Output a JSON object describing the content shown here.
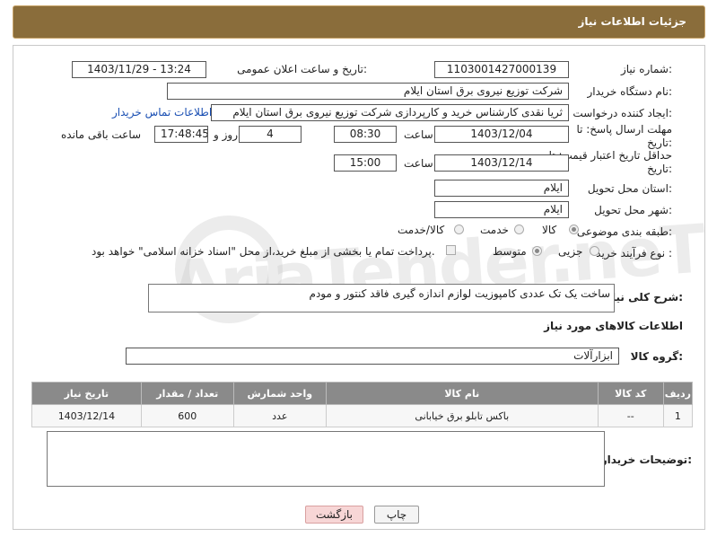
{
  "header": {
    "title": "جزئیات اطلاعات نیاز"
  },
  "form": {
    "need_number_label": "شماره نیاز:",
    "need_number": "1103001427000139",
    "announce_label": "تاریخ و ساعت اعلان عمومی:",
    "announce_value": "1403/11/29 - 13:24",
    "buyer_org_label": "نام دستگاه خریدار:",
    "buyer_org": "شرکت توزیع نیروی برق استان ایلام",
    "requester_label": "ایجاد کننده درخواست:",
    "requester": "ثریا نقدی کارشناس خرید و کارپردازی شرکت توزیع نیروی برق استان ایلام",
    "contact_link": "اطلاعات تماس خریدار",
    "deadline_label": "مهلت ارسال پاسخ: تا تاریخ:",
    "deadline_date": "1403/12/04",
    "time_label": "ساعت",
    "deadline_time": "08:30",
    "days_value": "4",
    "days_label": "روز و",
    "remaining_time": "17:48:45",
    "remaining_label": "ساعت باقی مانده",
    "validity_label": "حداقل تاریخ اعتبار قیمت: تا تاریخ:",
    "validity_date": "1403/12/14",
    "validity_time": "15:00",
    "province_label": "استان محل تحویل:",
    "province": "ایلام",
    "city_label": "شهر محل تحویل:",
    "city": "ایلام",
    "category_label": "طبقه بندی موضوعی:",
    "category_options": [
      "کالا",
      "خدمت",
      "کالا/خدمت"
    ],
    "category_selected": "کالا",
    "process_label": "نوع فرآیند خرید :",
    "process_options": [
      "جزیی",
      "متوسط"
    ],
    "payment_note": "پرداخت تمام یا بخشی از مبلغ خرید،از محل \"اسناد خزانه اسلامی\" خواهد بود.",
    "description_label": "شرح کلی نیاز:",
    "description": "ساخت یک تک عددی کامپوزیت لوازم اندازه گیری فاقد کنتور و مودم",
    "goods_info_title": "اطلاعات کالاهای مورد نیاز",
    "goods_group_label": "گروه کالا:",
    "goods_group": "ابزارآلات",
    "buyer_notes_label": "توضیحات خریدار:"
  },
  "table": {
    "headers": [
      "ردیف",
      "کد کالا",
      "نام کالا",
      "واحد شمارش",
      "تعداد / مقدار",
      "تاریخ نیاز"
    ],
    "rows": [
      [
        "1",
        "--",
        "باکس تابلو برق خیابانی",
        "عدد",
        "600",
        "1403/12/14"
      ]
    ]
  },
  "buttons": {
    "print": "چاپ",
    "back": "بازگشت"
  },
  "watermark": "AriaTender.neT",
  "colors": {
    "header_bg": "#8a6d3b",
    "table_header": "#8a8a8a",
    "link": "#1a4fb3",
    "back_btn": "#f7d6d6"
  }
}
